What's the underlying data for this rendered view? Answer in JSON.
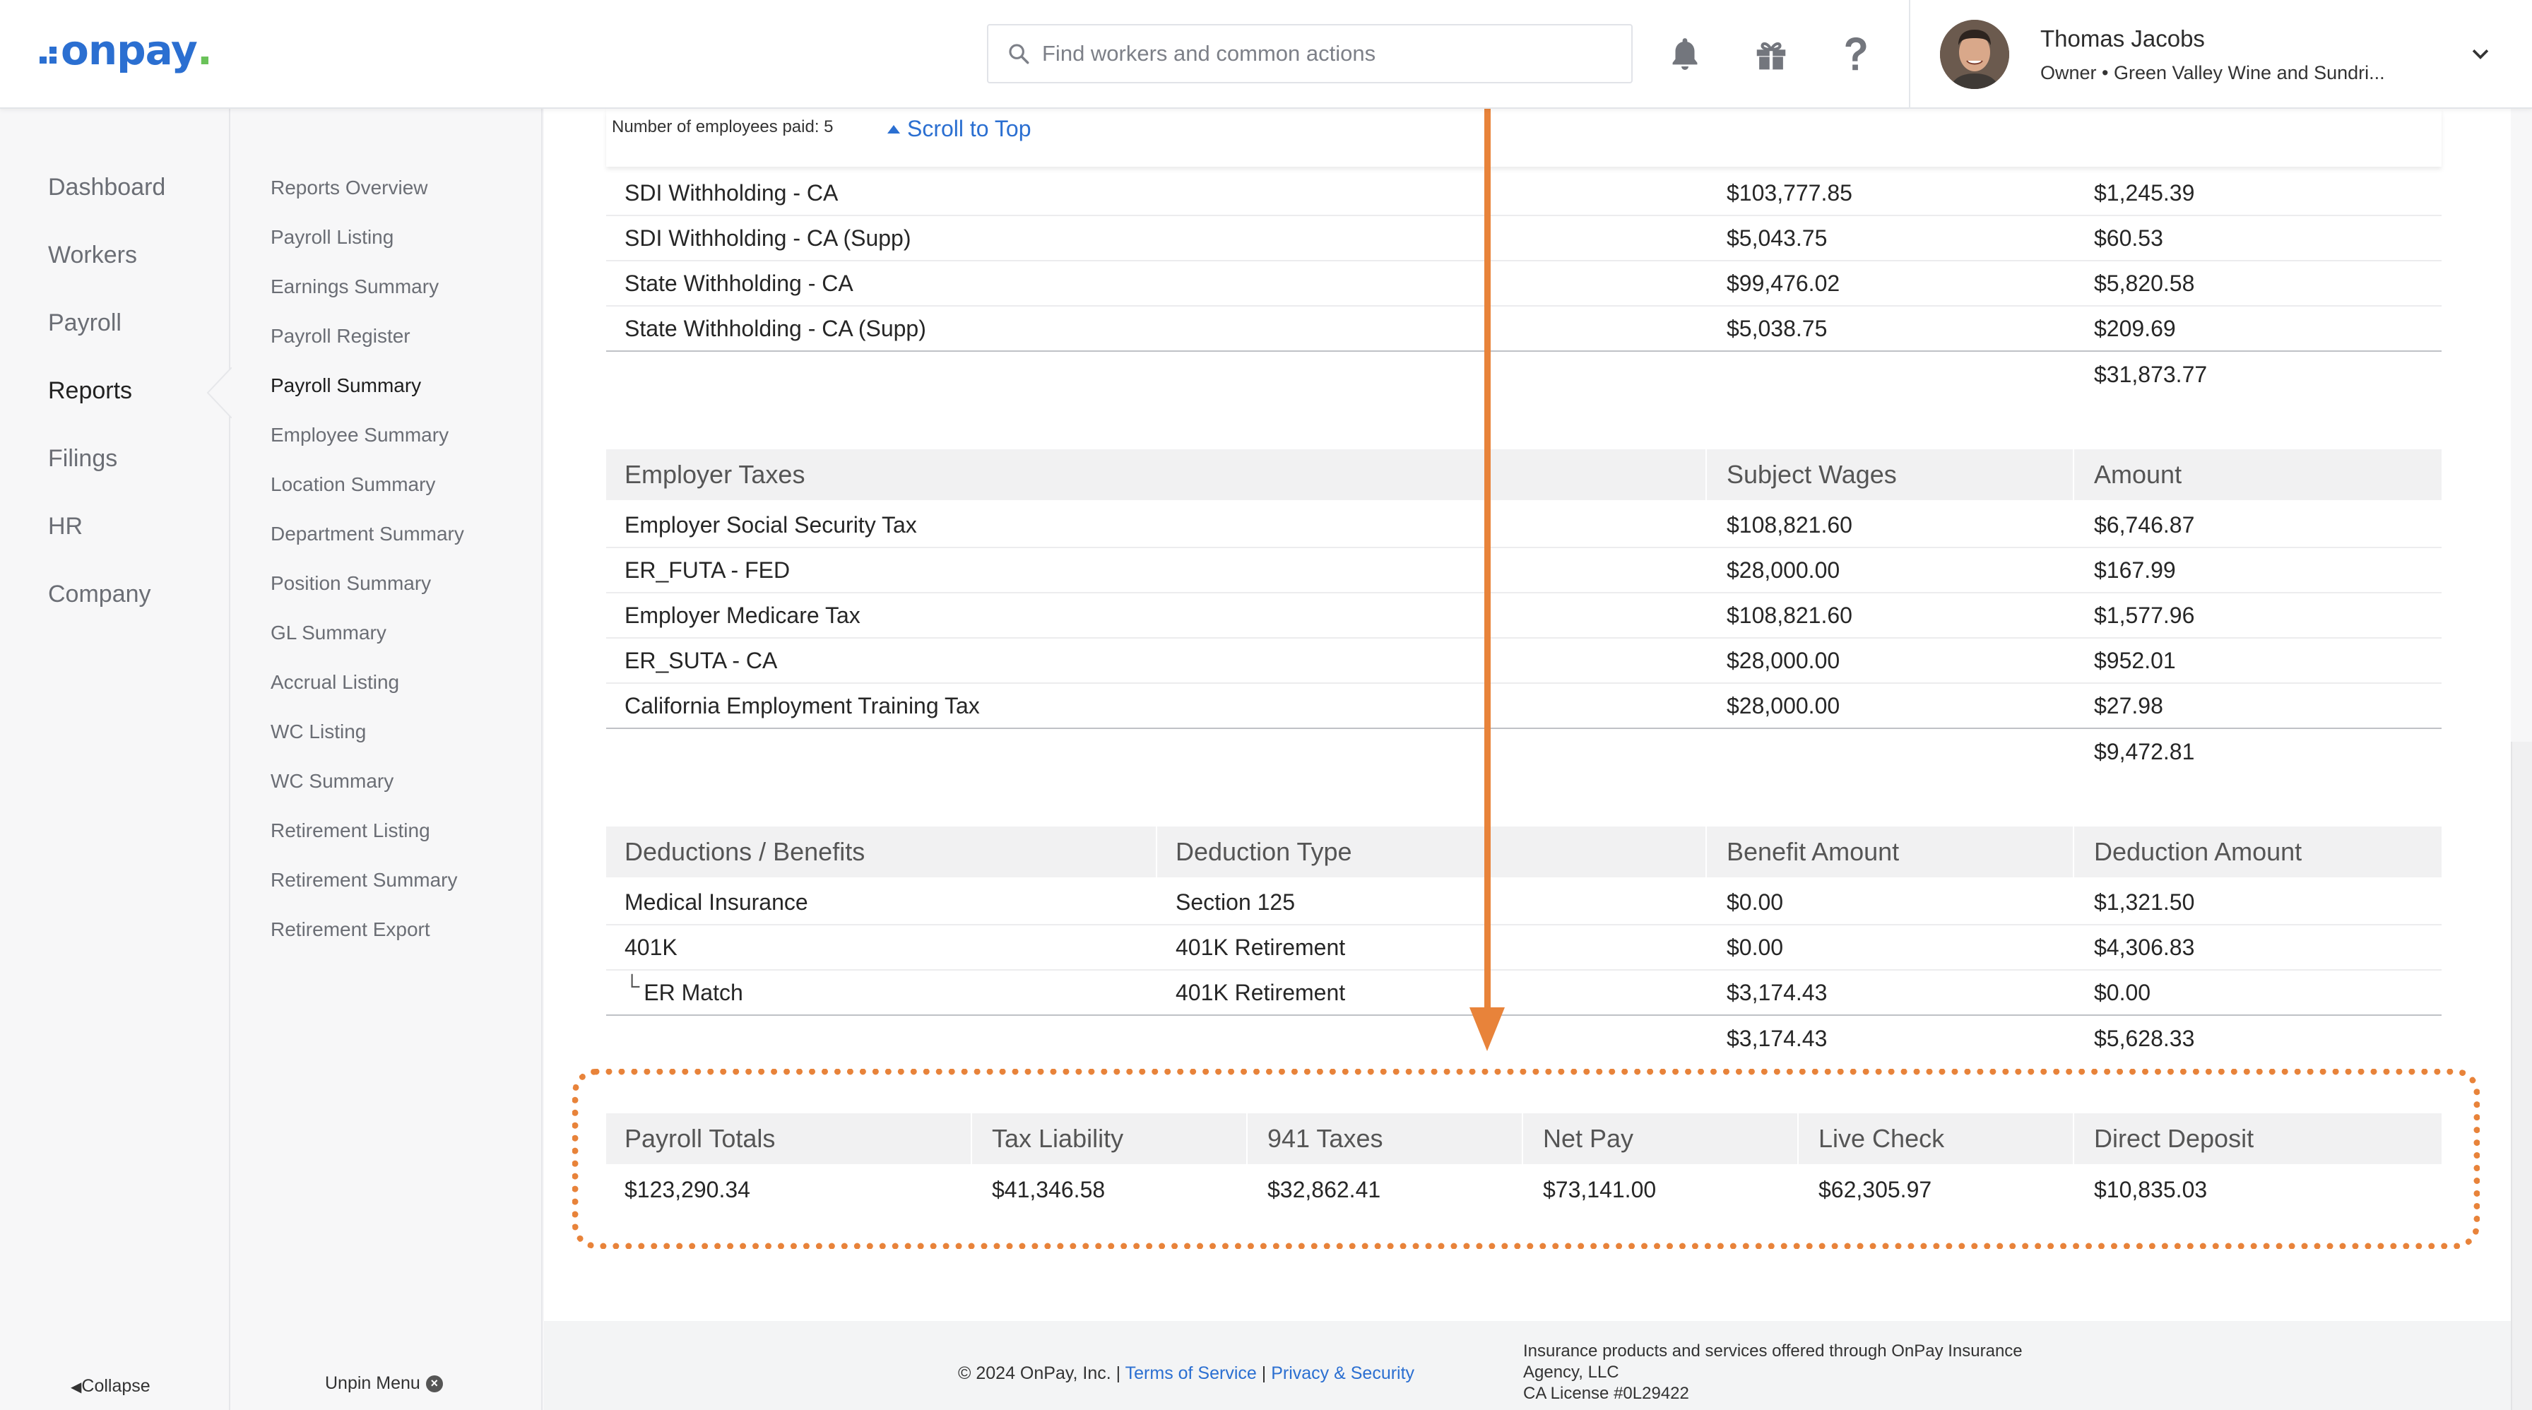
{
  "header": {
    "logo_text": "onpay",
    "search_placeholder": "Find workers and common actions",
    "user_name": "Thomas Jacobs",
    "user_subtitle": "Owner • Green Valley Wine and Sundri..."
  },
  "nav_primary": {
    "items": [
      "Dashboard",
      "Workers",
      "Payroll",
      "Reports",
      "Filings",
      "HR",
      "Company"
    ],
    "active": "Reports",
    "collapse_label": "Collapse"
  },
  "nav_secondary": {
    "items": [
      "Reports Overview",
      "Payroll Listing",
      "Earnings Summary",
      "Payroll Register",
      "Payroll Summary",
      "Employee Summary",
      "Location Summary",
      "Department Summary",
      "Position Summary",
      "GL Summary",
      "Accrual Listing",
      "WC Listing",
      "WC Summary",
      "Retirement Listing",
      "Retirement Summary",
      "Retirement Export"
    ],
    "active": "Payroll Summary",
    "unpin_label": "Unpin Menu"
  },
  "sticky": {
    "employees_paid": "Number of employees paid: 5",
    "scroll_top": "Scroll to Top"
  },
  "employee_withholding": {
    "rows": [
      {
        "name": "SDI Withholding - CA",
        "wages": "$103,777.85",
        "amount": "$1,245.39"
      },
      {
        "name": "SDI Withholding - CA (Supp)",
        "wages": "$5,043.75",
        "amount": "$60.53"
      },
      {
        "name": "State Withholding - CA",
        "wages": "$99,476.02",
        "amount": "$5,820.58"
      },
      {
        "name": "State Withholding - CA (Supp)",
        "wages": "$5,038.75",
        "amount": "$209.69"
      }
    ],
    "total": "$31,873.77"
  },
  "employer_taxes": {
    "headers": [
      "Employer Taxes",
      "Subject Wages",
      "Amount"
    ],
    "rows": [
      {
        "name": "Employer Social Security Tax",
        "wages": "$108,821.60",
        "amount": "$6,746.87"
      },
      {
        "name": "ER_FUTA - FED",
        "wages": "$28,000.00",
        "amount": "$167.99"
      },
      {
        "name": "Employer Medicare Tax",
        "wages": "$108,821.60",
        "amount": "$1,577.96"
      },
      {
        "name": "ER_SUTA - CA",
        "wages": "$28,000.00",
        "amount": "$952.01"
      },
      {
        "name": "California Employment Training Tax",
        "wages": "$28,000.00",
        "amount": "$27.98"
      }
    ],
    "total": "$9,472.81"
  },
  "deductions": {
    "headers": [
      "Deductions / Benefits",
      "Deduction Type",
      "Benefit Amount",
      "Deduction Amount"
    ],
    "rows": [
      {
        "name": "Medical Insurance",
        "type": "Section 125",
        "benefit": "$0.00",
        "deduction": "$1,321.50",
        "indent": false
      },
      {
        "name": "401K",
        "type": "401K Retirement",
        "benefit": "$0.00",
        "deduction": "$4,306.83",
        "indent": false
      },
      {
        "name": "ER Match",
        "type": "401K Retirement",
        "benefit": "$3,174.43",
        "deduction": "$0.00",
        "indent": true
      }
    ],
    "total_benefit": "$3,174.43",
    "total_deduction": "$5,628.33"
  },
  "payroll_totals": {
    "headers": [
      "Payroll Totals",
      "Tax Liability",
      "941 Taxes",
      "Net Pay",
      "Live Check",
      "Direct Deposit"
    ],
    "values": [
      "$123,290.34",
      "$41,346.58",
      "$32,862.41",
      "$73,141.00",
      "$62,305.97",
      "$10,835.03"
    ]
  },
  "footer": {
    "copyright": "© 2024 OnPay, Inc. |",
    "terms": "Terms of Service",
    "separator": "|",
    "privacy": "Privacy & Security",
    "insurance_line1": "Insurance products and services offered through OnPay Insurance",
    "insurance_line2": "Agency, LLC",
    "insurance_line3": "CA License #0L29422"
  },
  "colors": {
    "brand_blue": "#2b6fd1",
    "annotation_orange": "#e8833a"
  }
}
